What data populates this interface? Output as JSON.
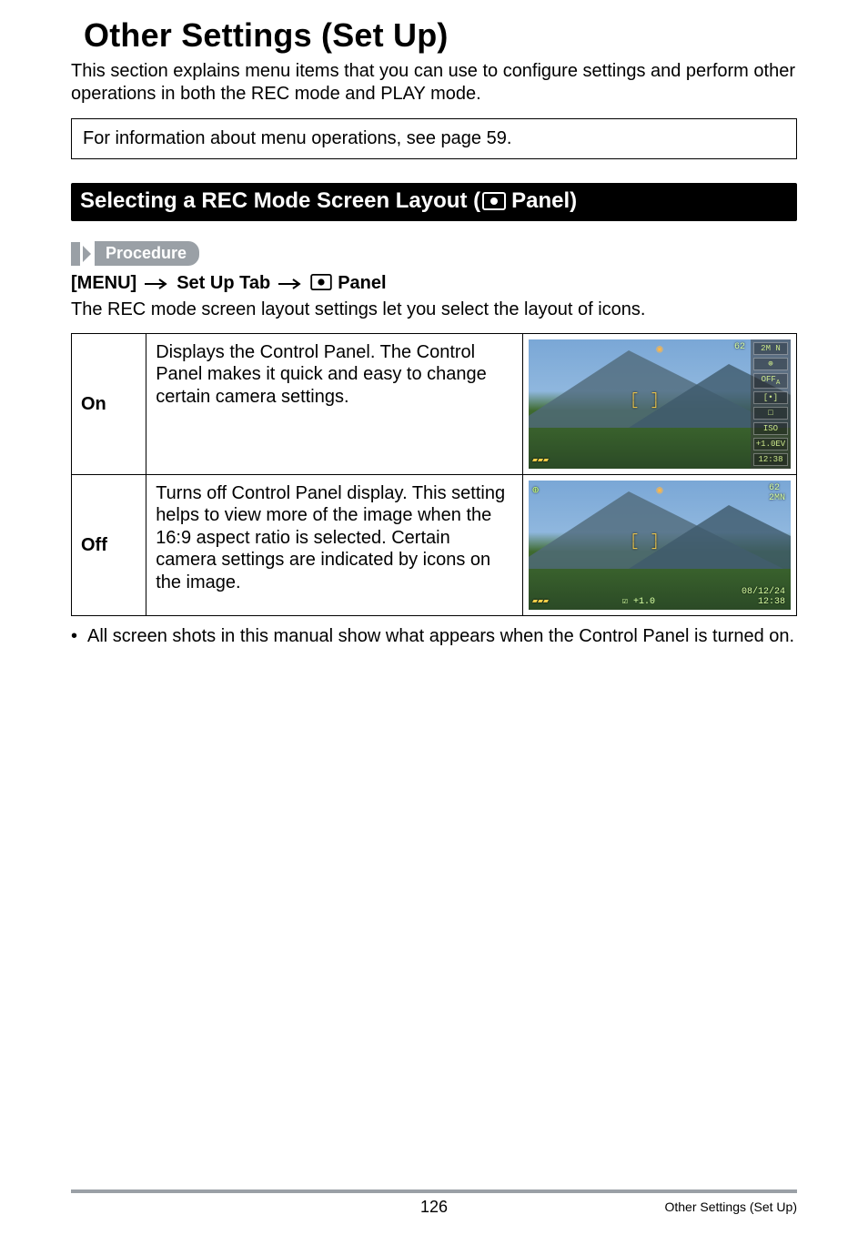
{
  "page": {
    "title": "Other Settings (Set Up)",
    "intro": "This section explains menu items that you can use to configure settings and perform other operations in both the REC mode and PLAY mode.",
    "note": "For information about menu operations, see page 59.",
    "number": "126",
    "footer_section": "Other Settings (Set Up)"
  },
  "section": {
    "title_pre": "Selecting a REC Mode Screen Layout (",
    "title_post": " Panel)",
    "procedure_label": "Procedure",
    "path": {
      "p1": "[MENU]",
      "p2": "Set Up Tab",
      "p3": " Panel"
    },
    "desc": "The REC mode screen layout settings let you select the layout of icons."
  },
  "options": {
    "on": {
      "label": "On",
      "text": "Displays the Control Panel. The Control Panel makes it quick and easy to change certain camera settings.",
      "sample": {
        "count": "62",
        "size": "2M",
        "q": "N",
        "flash": "⊕",
        "off": "OFF",
        "af": "A",
        "meter": "[•]",
        "cont": "□",
        "iso": "ISO",
        "ev": "+1.0EV",
        "time": "12:38"
      }
    },
    "off": {
      "label": "Off",
      "text": "Turns off Control Panel display. This setting helps to view more of the image when the 16:9 aspect ratio is selected. Certain camera settings are indicated by icons on the image.",
      "sample": {
        "count": "62",
        "size": "2M",
        "q": "N",
        "date": "08/12/24",
        "time": "12:38",
        "ev": "+1.0"
      }
    }
  },
  "note_bullet": "All screen shots in this manual show what appears when the Control Panel is turned on."
}
